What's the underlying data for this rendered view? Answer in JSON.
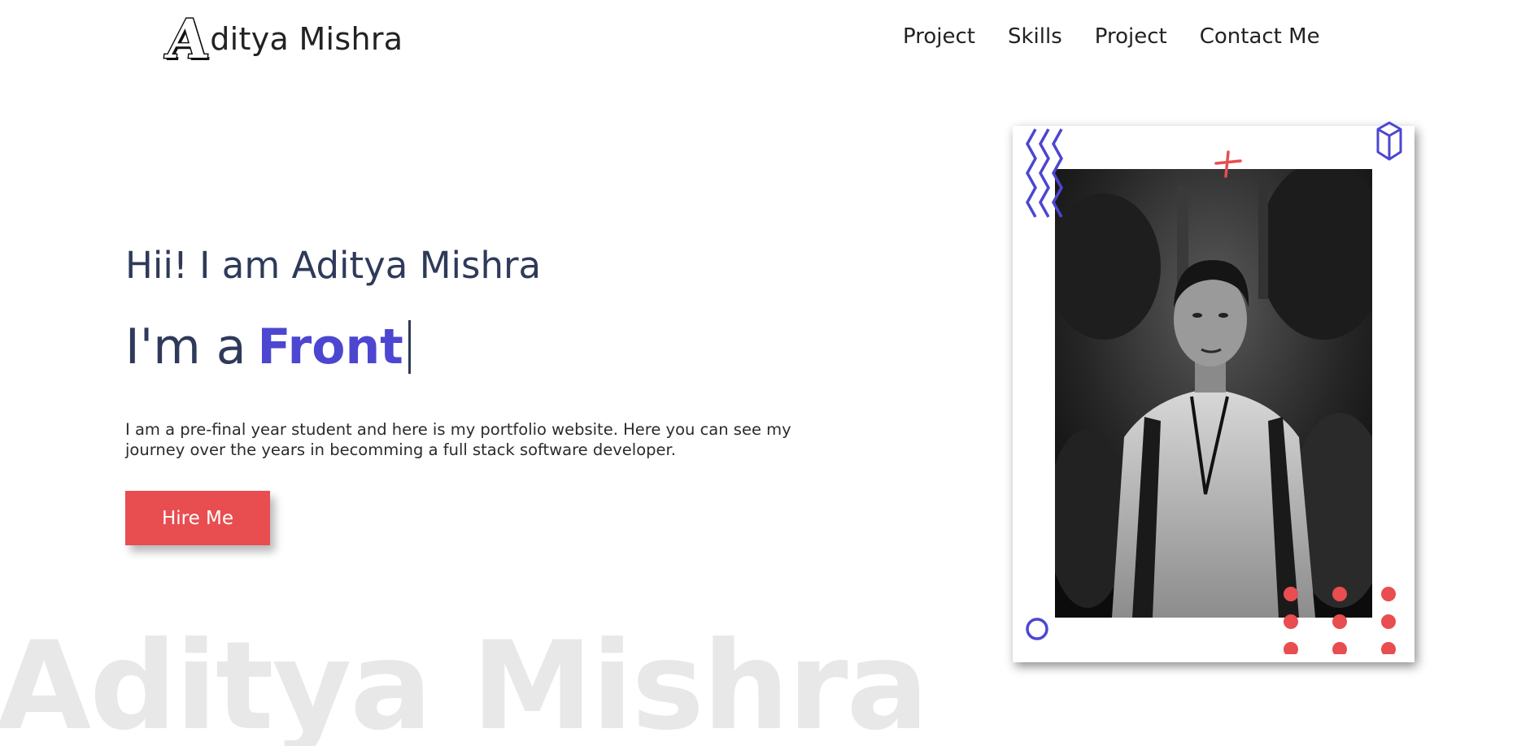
{
  "header": {
    "logo_initial": "A",
    "logo_rest": "ditya Mishra",
    "nav": [
      "Project",
      "Skills",
      "Project",
      "Contact Me"
    ]
  },
  "hero": {
    "greeting": "Hii! I am Aditya Mishra",
    "role_prefix": "I'm a",
    "role_word": "Front",
    "description": "I am a pre-final year student and here is my portfolio website. Here you can see my journey over the years in becomming a full stack software developer.",
    "cta_label": "Hire Me",
    "background_text": "Aditya Mishra"
  },
  "colors": {
    "accent_purple": "#4c46d1",
    "accent_red": "#e84d4f",
    "heading_navy": "#2f3a5a"
  },
  "icons": {
    "zigzag": "zigzag-decoration-icon",
    "cross": "cross-decoration-icon",
    "cube": "cube-decoration-icon",
    "circle": "ring-decoration-icon",
    "dots": "dot-grid-decoration-icon"
  }
}
